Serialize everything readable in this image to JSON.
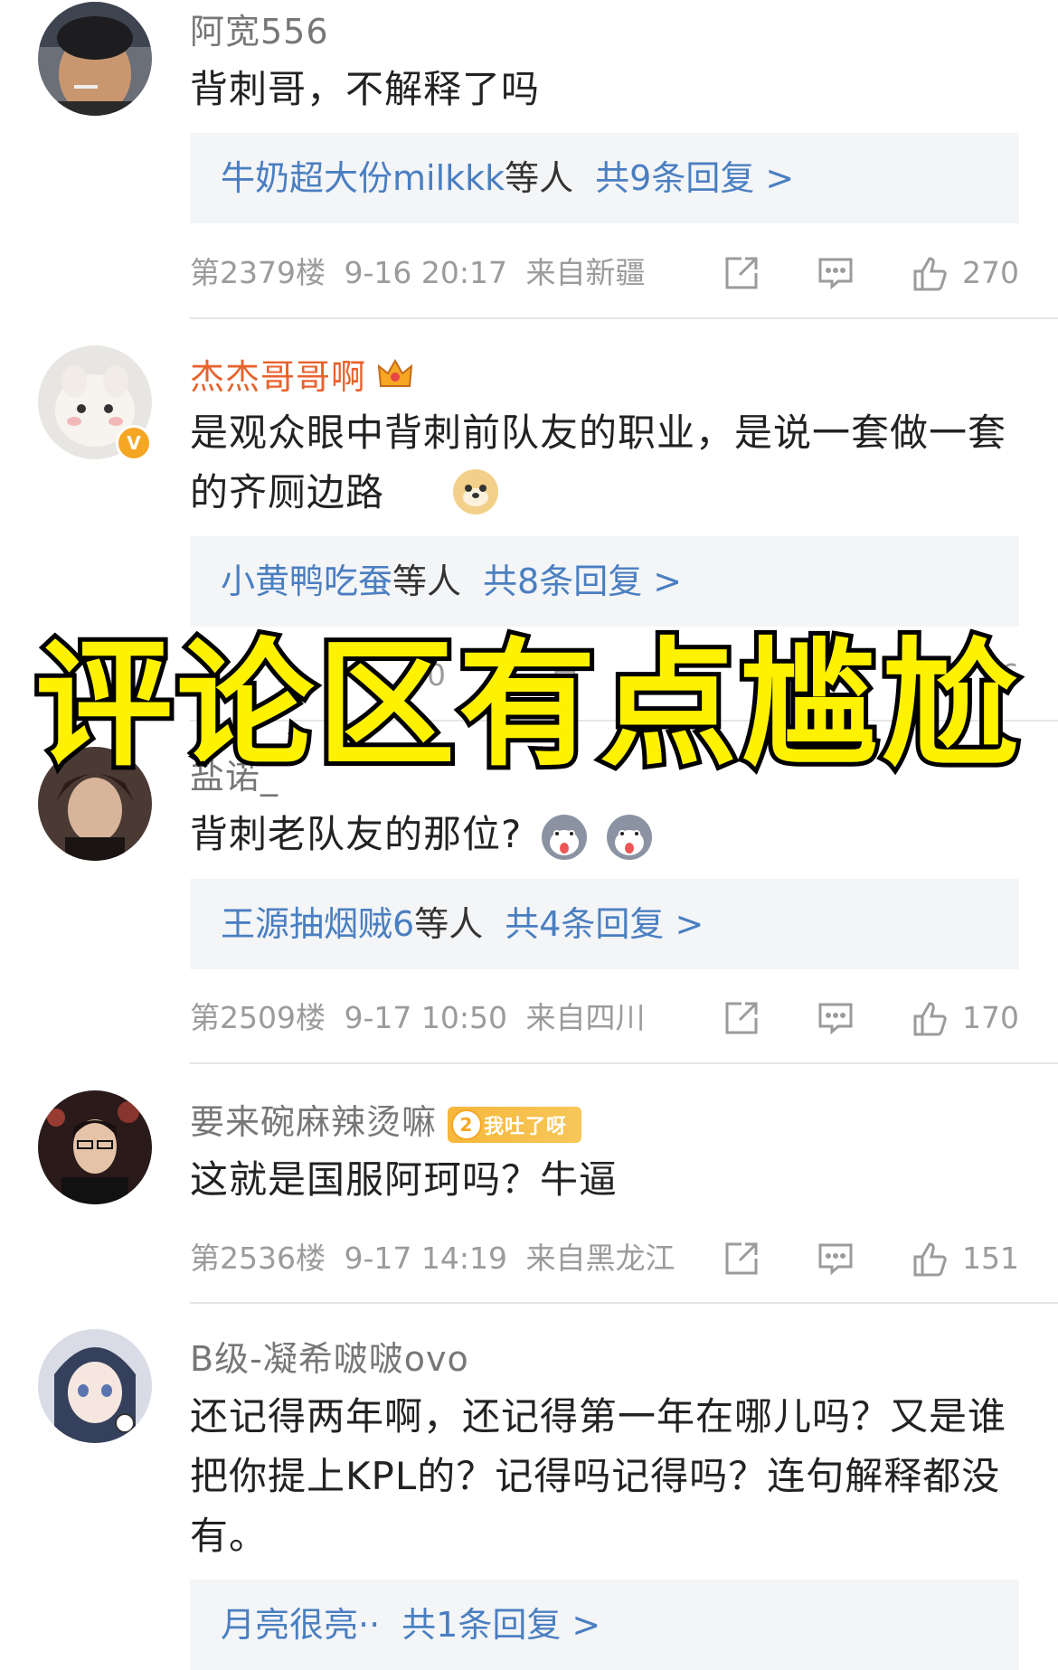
{
  "overlay_title": "评论区有点尴尬",
  "comments": [
    {
      "username": "阿宽556",
      "text": "背刺哥，不解释了吗",
      "reply_names": "牛奶超大份milkkk",
      "reply_mid": "等人",
      "reply_count": "共9条回复 >",
      "floor": "第2379楼",
      "datetime": "9-16 20:17",
      "location": "来自新疆",
      "likes": "270"
    },
    {
      "username": "杰杰哥哥啊",
      "text": "是观众眼中背刺前队友的职业，是说一套做一套的齐厕边路",
      "reply_names": "小黄鸭吃蚕",
      "reply_mid": "等人",
      "reply_count": "共8条回复 >",
      "meta_partial_left": "0",
      "meta_partial_mid": "自",
      "likes_partial": "66"
    },
    {
      "username": "盐诺_",
      "text": "背刺老队友的那位?",
      "reply_names": "王源抽烟贼6",
      "reply_mid": "等人",
      "reply_count": "共4条回复 >",
      "floor": "第2509楼",
      "datetime": "9-17 10:50",
      "location": "来自四川",
      "likes": "170"
    },
    {
      "username": "要来碗麻辣烫嘛",
      "badge_level": "2",
      "badge_text": "我吐了呀",
      "text": "这就是国服阿珂吗？牛逼",
      "floor": "第2536楼",
      "datetime": "9-17 14:19",
      "location": "来自黑龙江",
      "likes": "151"
    },
    {
      "username": "B级-凝希啵啵ovo",
      "text": "还记得两年啊，还记得第一年在哪儿吗？又是谁把你提上KPL的？记得吗记得吗？连句解释都没有。",
      "reply_names": "月亮很亮··",
      "reply_count": "共1条回复 >"
    }
  ],
  "icons": {
    "share": "share-icon",
    "comment": "comment-icon",
    "like": "like-icon",
    "verified": "verified-badge-icon",
    "crown": "crown-icon",
    "doge": "doge-emoji",
    "husky": "husky-emoji"
  },
  "colors": {
    "reply_link": "#4a7fc1",
    "username_vip": "#e8622c",
    "meta_gray": "#9b9b9b",
    "overlay_yellow": "#fff200"
  }
}
